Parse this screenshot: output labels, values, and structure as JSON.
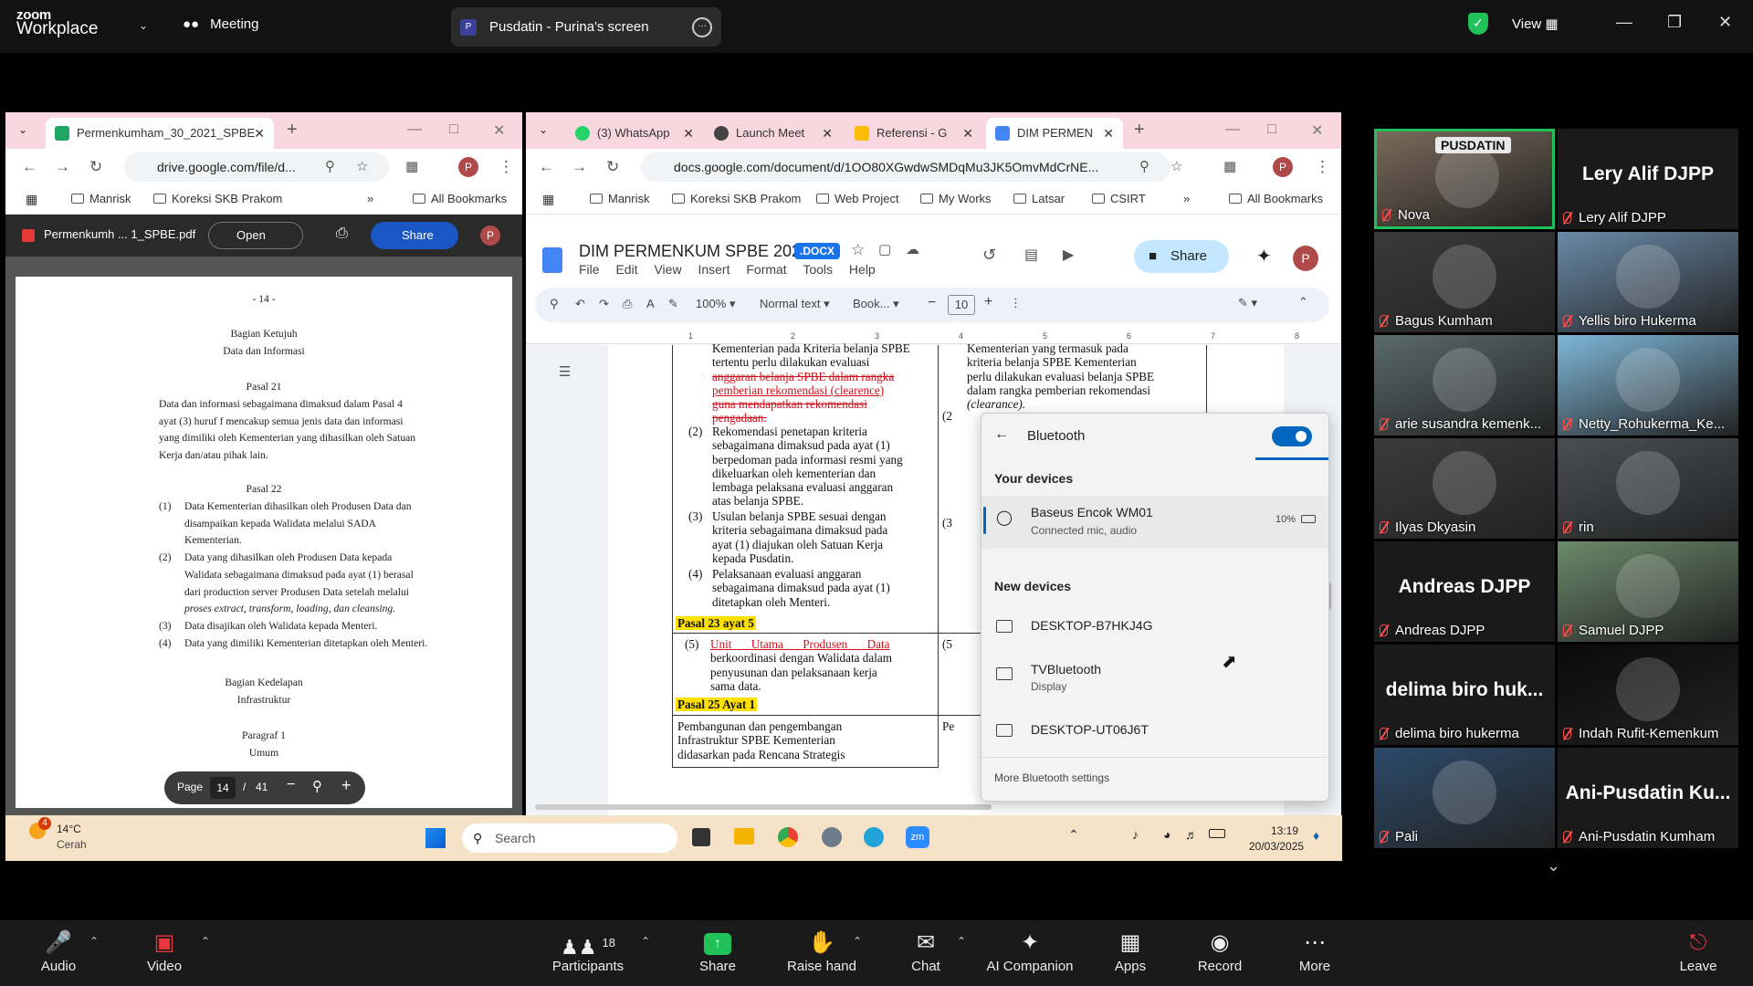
{
  "zoom": {
    "logo_top": "zoom",
    "logo_bottom": "Workplace",
    "meeting_label": "Meeting",
    "share_title": "Pusdatin - Purina's screen",
    "view_label": "View"
  },
  "pdf_window": {
    "tab_title": "Permenkumham_30_2021_SPBE",
    "url": "drive.google.com/file/d...",
    "bookmarks": [
      "Manrisk",
      "Koreksi SKB Prakom"
    ],
    "all_bookmarks": "All Bookmarks",
    "file_name": "Permenkumh ... 1_SPBE.pdf",
    "open_label": "Open",
    "share_label": "Share",
    "avatar": "P",
    "page_label": "Page",
    "page_current": "14",
    "page_sep": "/",
    "page_total": "41",
    "page_header": "- 14 -",
    "section_title": "Bagian Ketujuh",
    "section_sub": "Data dan Informasi",
    "pasal21": "Pasal 21",
    "pasal21_text": [
      "Data dan informasi sebagaimana dimaksud dalam Pasal 4",
      "ayat (3) huruf f mencakup semua jenis data dan informasi",
      "yang dimiliki oleh Kementerian yang dihasilkan oleh Satuan",
      "Kerja dan/atau pihak lain."
    ],
    "pasal22": "Pasal 22",
    "p22_items": [
      {
        "n": "(1)",
        "lines": [
          "Data Kementerian dihasilkan oleh Produsen Data dan",
          "disampaikan kepada Walidata melalui SADA",
          "Kementerian."
        ]
      },
      {
        "n": "(2)",
        "lines": [
          "Data yang dihasilkan oleh Produsen Data kepada",
          "Walidata sebagaimana dimaksud pada ayat (1) berasal",
          "dari production server Produsen Data setelah melalui",
          "proses extract, transform, loading, dan cleansing."
        ]
      },
      {
        "n": "(3)",
        "lines": [
          "Data disajikan oleh Walidata kepada Menteri."
        ]
      },
      {
        "n": "(4)",
        "lines": [
          "Data yang dimiliki Kementerian ditetapkan oleh Menteri."
        ]
      }
    ],
    "section2_title": "Bagian Kedelapan",
    "section2_sub": "Infrastruktur",
    "paragraf": "Paragraf 1",
    "umum": "Umum"
  },
  "docs_window": {
    "tabs": [
      "(3) WhatsApp",
      "Launch Meet",
      "Referensi - G",
      "DIM PERMEN"
    ],
    "url": "docs.google.com/document/d/1OO80XGwdwSMDqMu3JK5OmvMdCrNE...",
    "bookmarks": [
      "Manrisk",
      "Koreksi SKB Prakom",
      "Web Project",
      "My Works",
      "Latsar",
      "CSIRT"
    ],
    "all_bookmarks": "All Bookmarks",
    "doc_title": "DIM PERMENKUM SPBE 2025",
    "doc_badge": ".DOCX",
    "menus": [
      "File",
      "Edit",
      "View",
      "Insert",
      "Format",
      "Tools",
      "Help"
    ],
    "share_label": "Share",
    "avatar": "P",
    "zoom": "100%",
    "style": "Normal text",
    "font": "Book...",
    "font_size": "10",
    "ruler_marks": [
      "1",
      "2",
      "3",
      "4",
      "5",
      "6",
      "7",
      "8"
    ],
    "col1_top_lines": [
      "Kementerian pada Kriteria belanja SPBE",
      "tertentu perlu dilakukan evaluasi"
    ],
    "col1_red_lines": [
      "anggaran belanja SPBE dalam rangka",
      "pemberian rekomendasi (clearence)",
      "guna mendapatkan rekomendasi",
      "pengadaan."
    ],
    "item2_n": "(2)",
    "item2_lines": [
      "Rekomendasi penetapan kriteria",
      "sebagaimana dimaksud pada ayat (1)",
      "berpedoman pada informasi resmi yang",
      "dikeluarkan oleh kementerian dan",
      "lembaga pelaksana evaluasi anggaran",
      "atas belanja SPBE."
    ],
    "item3_n": "(3)",
    "item3_lines": [
      "Usulan belanja SPBE sesuai dengan",
      "kriteria sebagaimana dimaksud pada",
      "ayat (1) diajukan oleh Satuan Kerja",
      "kepada Pusdatin."
    ],
    "item4_n": "(4)",
    "item4_lines": [
      "Pelaksanaan evaluasi anggaran",
      "sebagaimana dimaksud pada ayat (1)",
      "ditetapkan oleh Menteri."
    ],
    "hl1": "Pasal 23 ayat 5",
    "item5_n": "(5)",
    "item5_red": "Unit Utama Produsen Data",
    "item5_lines": [
      "berkoordinasi dengan Walidata dalam",
      "penyusunan dan pelaksanaan kerja",
      "sama data."
    ],
    "hl2": "Pasal 25 Ayat 1",
    "p25_lines": [
      "Pembangunan dan pengembangan",
      "Infrastruktur SPBE Kementerian",
      "didasarkan pada Rencana Strategis"
    ],
    "col2_lines": [
      "Kementerian yang termasuk pada",
      "kriteria belanja SPBE Kementerian",
      "perlu dilakukan evaluasi belanja SPBE",
      "dalam rangka pemberian rekomendasi",
      "(clearance)."
    ],
    "col2_markers": [
      "(2",
      "(3",
      "(5",
      "Pe"
    ]
  },
  "bluetooth": {
    "title": "Bluetooth",
    "toggle_on": true,
    "your_devices": "Your devices",
    "connected": {
      "name": "Baseus Encok WM01",
      "status": "Connected mic, audio",
      "battery": "10%"
    },
    "new_devices": "New devices",
    "devices": [
      {
        "name": "DESKTOP-B7HKJ4G",
        "sub": ""
      },
      {
        "name": "TVBluetooth",
        "sub": "Display"
      },
      {
        "name": "DESKTOP-UT06J6T",
        "sub": ""
      }
    ],
    "more": "More Bluetooth settings"
  },
  "taskbar": {
    "weather_temp": "14°C",
    "weather_cond": "Cerah",
    "weather_badge": "4",
    "search": "Search",
    "time": "13:19",
    "date": "20/03/2025"
  },
  "participants": [
    {
      "name": "Nova",
      "big": "",
      "active": true
    },
    {
      "name": "Lery Alif DJPP",
      "big": "Lery Alif DJPP"
    },
    {
      "name": "Bagus Kumham",
      "big": ""
    },
    {
      "name": "Yellis biro Hukerma",
      "big": ""
    },
    {
      "name": "arie susandra kemenk...",
      "big": ""
    },
    {
      "name": "Netty_Rohukerma_Ke...",
      "big": ""
    },
    {
      "name": "Ilyas Dkyasin",
      "big": ""
    },
    {
      "name": "rin",
      "big": ""
    },
    {
      "name": "Andreas DJPP",
      "big": "Andreas DJPP"
    },
    {
      "name": "Samuel DJPP",
      "big": ""
    },
    {
      "name": "delima biro hukerma",
      "big": "delima biro huk..."
    },
    {
      "name": "Indah Rufit-Kemenkum",
      "big": ""
    },
    {
      "name": "Pali",
      "big": ""
    },
    {
      "name": "Ani-Pusdatin Kumham",
      "big": "Ani-Pusdatin Ku..."
    }
  ],
  "tile_logo_text": "PUSDATIN",
  "toolbar": {
    "audio": "Audio",
    "video": "Video",
    "participants": "Participants",
    "participants_count": "18",
    "share": "Share",
    "raise_hand": "Raise hand",
    "chat": "Chat",
    "ai_companion": "AI Companion",
    "apps": "Apps",
    "record": "Record",
    "more": "More",
    "leave": "Leave"
  },
  "colors": {
    "zoom_green": "#21c15a",
    "leave_red": "#e8383d",
    "highlight": "#ffe100",
    "chrome_pink": "#f8d7e0",
    "toggle_blue": "#0067c0"
  }
}
